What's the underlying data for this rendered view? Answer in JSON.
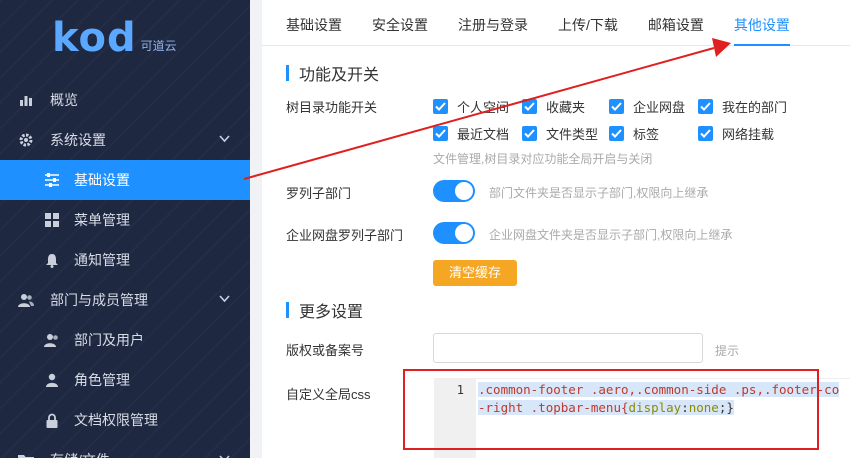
{
  "logo": {
    "text": "kod",
    "sub": "可道云"
  },
  "sidebar": {
    "items": [
      {
        "label": "概览",
        "icon": "bar-chart-icon"
      },
      {
        "label": "系统设置",
        "icon": "gear-icon"
      },
      {
        "label": "基础设置",
        "icon": "sliders-icon"
      },
      {
        "label": "菜单管理",
        "icon": "grid-icon"
      },
      {
        "label": "通知管理",
        "icon": "bell-icon"
      },
      {
        "label": "部门与成员管理",
        "icon": "users-icon"
      },
      {
        "label": "部门及用户",
        "icon": "users-icon"
      },
      {
        "label": "角色管理",
        "icon": "user-icon"
      },
      {
        "label": "文档权限管理",
        "icon": "lock-icon"
      },
      {
        "label": "存储/文件",
        "icon": "folder-icon"
      }
    ]
  },
  "tabs": [
    "基础设置",
    "安全设置",
    "注册与登录",
    "上传/下载",
    "邮箱设置",
    "其他设置"
  ],
  "section1": {
    "title": "功能及开关"
  },
  "tree_switch": {
    "label": "树目录功能开关",
    "options": [
      "个人空间",
      "收藏夹",
      "企业网盘",
      "我在的部门",
      "最近文档",
      "文件类型",
      "标签",
      "网络挂载"
    ],
    "hint": "文件管理,树目录对应功能全局开启与关闭"
  },
  "list_sub": {
    "label": "罗列子部门",
    "hint": "部门文件夹是否显示子部门,权限向上继承",
    "on": true
  },
  "group_sub": {
    "label": "企业网盘罗列子部门",
    "hint": "企业网盘文件夹是否显示子部门,权限向上继承",
    "on": true
  },
  "clear_cache": {
    "label": "清空缓存"
  },
  "section2": {
    "title": "更多设置"
  },
  "copyright": {
    "label": "版权或备案号",
    "value": "",
    "hint": "提示"
  },
  "custom_css": {
    "label": "自定义全局css",
    "line_number": "1",
    "line1": ".common-footer .aero,.common-side .ps,.footer-co",
    "line2a": "-right .topbar-menu{",
    "line2b": "display",
    "line2c": ":",
    "line2d": "none",
    "line2e": ";}"
  },
  "colors": {
    "accent": "#1e90ff",
    "sidebar": "#1f2841",
    "annotation": "#e02020",
    "button": "#f5a623"
  }
}
